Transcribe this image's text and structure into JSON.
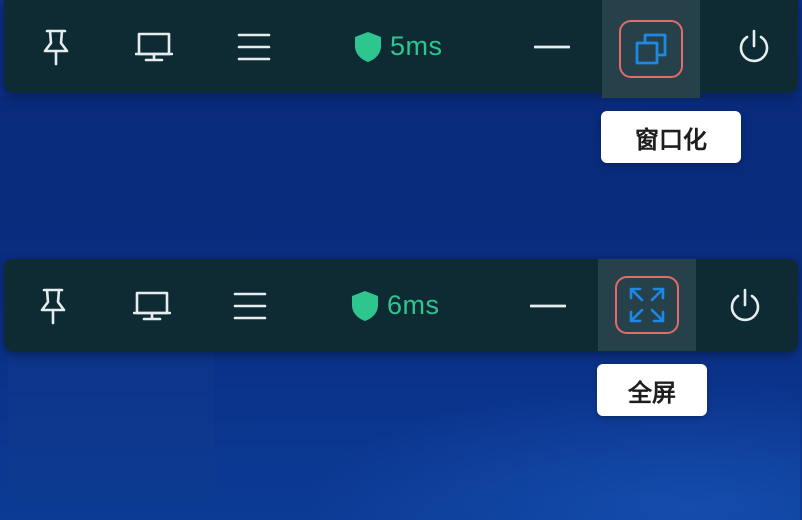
{
  "toolbar_1": {
    "icons": [
      "pin-icon",
      "monitor-icon",
      "menu-icon",
      "shield-icon",
      "minimize-icon",
      "window-mode-icon",
      "power-icon"
    ],
    "ping": "5ms",
    "tooltip": "窗口化"
  },
  "toolbar_2": {
    "icons": [
      "pin-icon",
      "monitor-icon",
      "menu-icon",
      "shield-icon",
      "minimize-icon",
      "fullscreen-icon",
      "power-icon"
    ],
    "ping": "6ms",
    "tooltip": "全屏"
  },
  "colors": {
    "toolbar_bg": "#0e2b33",
    "ping_green": "#2fc58e",
    "highlight_blue": "#1e88e5",
    "annotation_red": "#e56a6a",
    "desktop_blue": "#0b2f86"
  }
}
